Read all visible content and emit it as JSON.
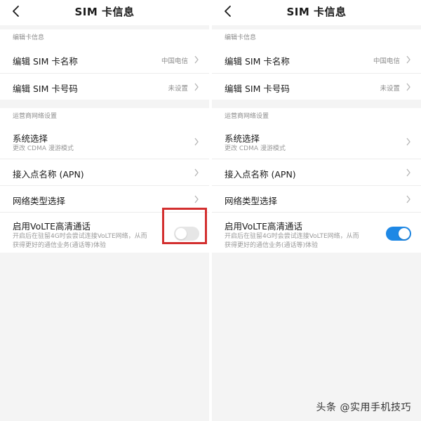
{
  "screen": {
    "title": "SIM  卡信息",
    "section_sim_label": "编辑卡信息",
    "section_network_label": "运营商网络设置",
    "rows": {
      "sim_name": {
        "label": "编辑 SIM 卡名称",
        "value": "中国电信"
      },
      "sim_number": {
        "label": "编辑 SIM 卡号码",
        "value": "未设置"
      },
      "system_select": {
        "label": "系统选择",
        "subtitle": "更改 CDMA 漫游模式"
      },
      "apn": {
        "label": "接入点名称 (APN)"
      },
      "network_type": {
        "label": "网络类型选择"
      },
      "volte": {
        "label": "启用VoLTE高清通话",
        "desc_line1": "开启后在驻留4G时会尝试连接VoLTE网络，从而",
        "desc_line2": "获得更好的通信业务(通话等)体验"
      }
    }
  },
  "left_pane": {
    "volte_enabled": false
  },
  "right_pane": {
    "volte_enabled": true
  },
  "colors": {
    "toggle_on": "#1e88e5",
    "toggle_off": "#e6e6e6",
    "highlight": "#d32f2f"
  },
  "icons": {
    "back": "chevron-left-icon",
    "row_arrow": "chevron-right-icon"
  },
  "watermark": "头条 @实用手机技巧"
}
